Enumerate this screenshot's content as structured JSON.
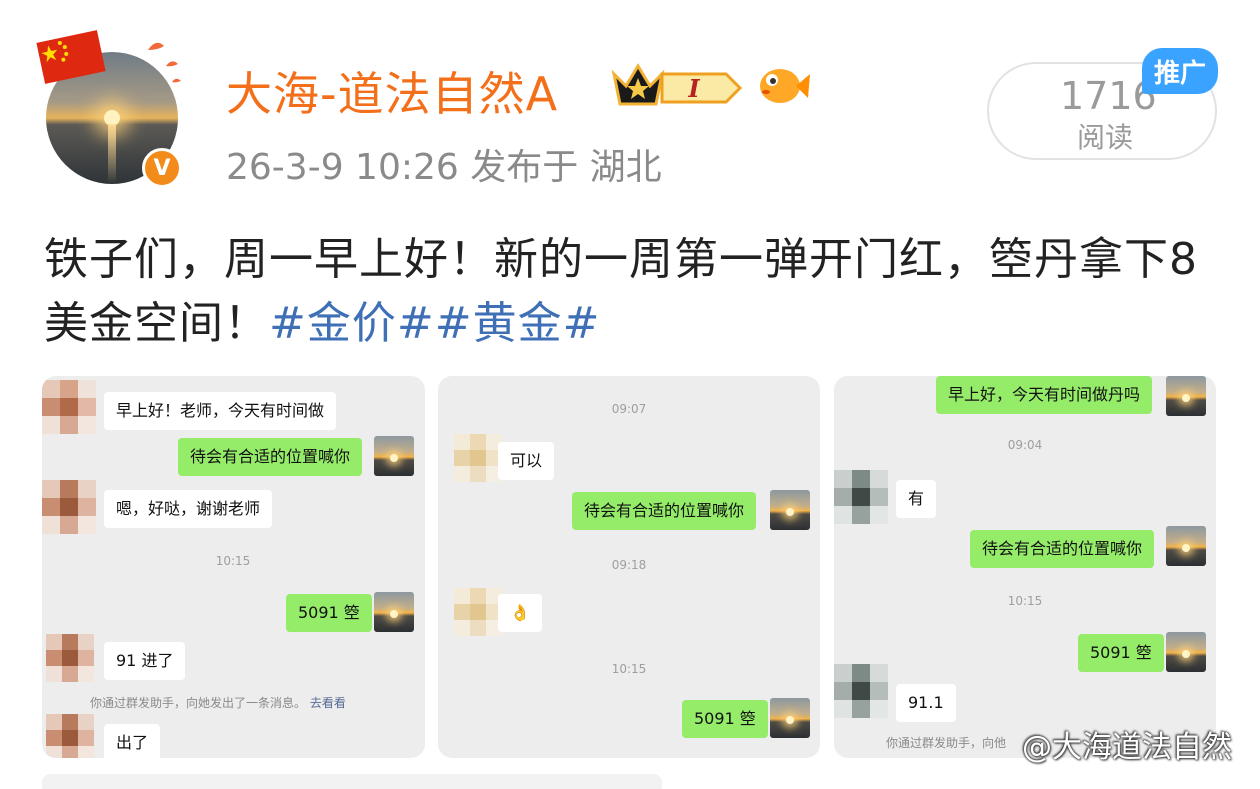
{
  "user": {
    "name": "大海-道法自然A",
    "level_badge": "I",
    "verified_mark": "V"
  },
  "post": {
    "meta": "26-3-9 10:26  发布于 湖北",
    "text_main": "铁子们，周一早上好！新的一周第一弹开门红，箜丹拿下8美金空间！",
    "tags": [
      "#金价#",
      "#黄金#"
    ]
  },
  "stats": {
    "read_count": "1716",
    "read_label": "阅读",
    "promo_label": "推广"
  },
  "screenshots": [
    {
      "messages": [
        {
          "side": "left",
          "text": "早上好！老师，今天有时间做"
        },
        {
          "side": "right",
          "text": "待会有合适的位置喊你"
        },
        {
          "side": "left",
          "text": "嗯，好哒，谢谢老师"
        },
        {
          "side": "time",
          "text": "10:15"
        },
        {
          "side": "right",
          "text": "5091 箜"
        },
        {
          "side": "left",
          "text": "91 进了"
        },
        {
          "side": "system",
          "text": "你通过群发助手，向她发出了一条消息。",
          "link": "去看看"
        },
        {
          "side": "left",
          "text": "出了"
        }
      ]
    },
    {
      "messages": [
        {
          "side": "time",
          "text": "09:07"
        },
        {
          "side": "left",
          "text": "可以"
        },
        {
          "side": "right",
          "text": "待会有合适的位置喊你"
        },
        {
          "side": "time",
          "text": "09:18"
        },
        {
          "side": "left",
          "text": "👌"
        },
        {
          "side": "time",
          "text": "10:15"
        },
        {
          "side": "right",
          "text": "5091 箜"
        }
      ]
    },
    {
      "messages": [
        {
          "side": "right",
          "text": "早上好，今天有时间做丹吗"
        },
        {
          "side": "time",
          "text": "09:04"
        },
        {
          "side": "left",
          "text": "有"
        },
        {
          "side": "right",
          "text": "待会有合适的位置喊你"
        },
        {
          "side": "time",
          "text": "10:15"
        },
        {
          "side": "right",
          "text": "5091 箜"
        },
        {
          "side": "left",
          "text": "91.1"
        },
        {
          "side": "system",
          "text": "你通过群发助手，向他"
        }
      ]
    }
  ],
  "watermark": "@大海道法自然",
  "colors": {
    "username": "#f36f1a",
    "tag": "#3f6fb5",
    "bubble_right": "#95ec69",
    "promo": "#3aa3ff"
  }
}
